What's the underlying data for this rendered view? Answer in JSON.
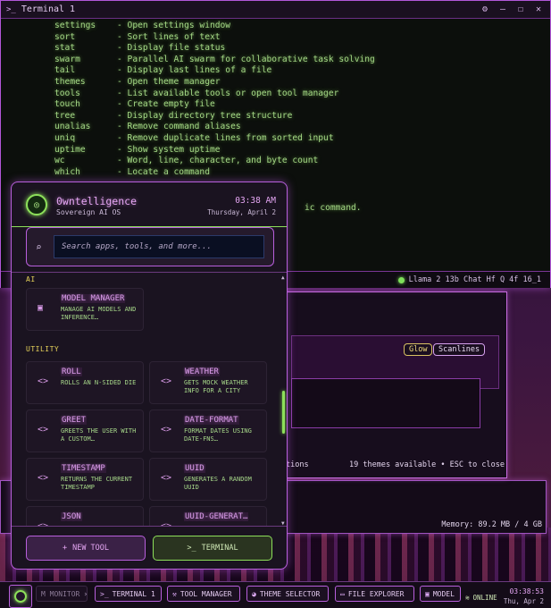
{
  "terminal": {
    "title": "Terminal 1",
    "commands": [
      {
        "cmd": "settings",
        "desc": "- Open settings window"
      },
      {
        "cmd": "sort",
        "desc": "- Sort lines of text"
      },
      {
        "cmd": "stat",
        "desc": "- Display file status"
      },
      {
        "cmd": "swarm",
        "desc": "- Parallel AI swarm for collaborative task solving"
      },
      {
        "cmd": "tail",
        "desc": "- Display last lines of a file"
      },
      {
        "cmd": "themes",
        "desc": "- Open theme manager"
      },
      {
        "cmd": "tools",
        "desc": "- List available tools or open tool manager"
      },
      {
        "cmd": "touch",
        "desc": "- Create empty file"
      },
      {
        "cmd": "tree",
        "desc": "- Display directory tree structure"
      },
      {
        "cmd": "unalias",
        "desc": "- Remove command aliases"
      },
      {
        "cmd": "uniq",
        "desc": "- Remove duplicate lines from sorted input"
      },
      {
        "cmd": "uptime",
        "desc": "- Show system uptime"
      },
      {
        "cmd": "wc",
        "desc": "- Word, line, character, and byte count"
      },
      {
        "cmd": "which",
        "desc": "- Locate a command"
      }
    ],
    "tail_fragment": "ic command.",
    "model_status": "Llama 2 13b Chat Hf Q 4f 16_1"
  },
  "theme_selector": {
    "tags": [
      "Glow",
      "Scanlines"
    ],
    "footer_left": "tions",
    "footer_right": "19 themes available • ESC to close"
  },
  "system_monitor": {
    "memory": "Memory: 89.2 MB / 4 GB"
  },
  "launcher": {
    "brand": "0wntelligence",
    "subtitle": "Sovereign AI OS",
    "time": "03:38 AM",
    "date": "Thursday, April 2",
    "search_placeholder": "Search apps, tools, and more...",
    "sections": [
      {
        "title": "AI",
        "items": [
          {
            "name": "MODEL MANAGER",
            "desc": "MANAGE AI MODELS AND INFERENCE…",
            "icon": "chip-icon"
          }
        ]
      },
      {
        "title": "UTILITY",
        "items": [
          {
            "name": "ROLL",
            "desc": "ROLLS AN N-SIDED DIE",
            "icon": "code-icon"
          },
          {
            "name": "WEATHER",
            "desc": "GETS MOCK WEATHER INFO FOR A CITY",
            "icon": "code-icon"
          },
          {
            "name": "GREET",
            "desc": "GREETS THE USER WITH A CUSTOM…",
            "icon": "code-icon"
          },
          {
            "name": "DATE-FORMAT",
            "desc": "FORMAT DATES USING DATE-FNS…",
            "icon": "code-icon"
          },
          {
            "name": "TIMESTAMP",
            "desc": "RETURNS THE CURRENT TIMESTAMP",
            "icon": "code-icon"
          },
          {
            "name": "UUID",
            "desc": "GENERATES A RANDOM UUID",
            "icon": "code-icon"
          },
          {
            "name": "JSON",
            "desc": "",
            "icon": "code-icon"
          },
          {
            "name": "UUID-GENERAT…",
            "desc": "",
            "icon": "code-icon"
          }
        ]
      }
    ],
    "new_tool_label": "NEW TOOL",
    "terminal_label": "TERMINAL"
  },
  "taskbar": {
    "items": [
      {
        "label": "M MONITOR ×",
        "icon": ""
      },
      {
        "label": "TERMINAL 1",
        "icon": ">_"
      },
      {
        "label": "TOOL MANAGER",
        "icon": "wrench-icon"
      },
      {
        "label": "THEME SELECTOR",
        "icon": "palette-icon"
      },
      {
        "label": "FILE EXPLORER",
        "icon": "folder-icon"
      },
      {
        "label": "MODEL",
        "icon": "chip-icon"
      }
    ],
    "status": "ONLINE",
    "time": "03:38:53",
    "date": "Thu, Apr 2"
  }
}
